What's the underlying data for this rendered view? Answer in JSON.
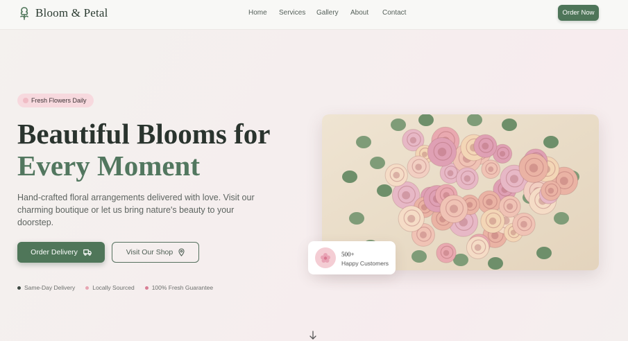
{
  "header": {
    "brand": "Bloom & Petal",
    "nav": [
      "Home",
      "Services",
      "Gallery",
      "About",
      "Contact"
    ],
    "cta": "Order Now"
  },
  "hero": {
    "badge": "Fresh Flowers Daily",
    "title_line1": "Beautiful Blooms for",
    "title_line2": "Every Moment",
    "description": "Hand-crafted floral arrangements delivered with love. Visit our charming boutique or let us bring nature's beauty to your doorstep.",
    "primary_button": "Order Delivery",
    "secondary_button": "Visit Our Shop",
    "features": [
      "Same-Day Delivery",
      "Locally Sourced",
      "100% Fresh Guarantee"
    ]
  },
  "stats_card": {
    "value": "500+",
    "label": "Happy Customers"
  },
  "colors": {
    "brand_green": "#4f7659",
    "accent_pink": "#f7d9de",
    "title_dark": "#2a342e",
    "title_green": "#52775f"
  },
  "icons": {
    "logo": "flower-bud-icon",
    "delivery": "truck-icon",
    "shop": "map-pin-icon",
    "card": "flower-icon",
    "scroll": "arrow-down-icon"
  }
}
